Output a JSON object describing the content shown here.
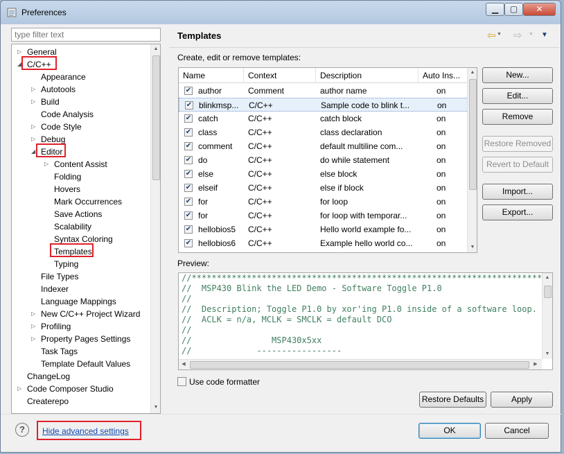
{
  "window": {
    "title": "Preferences",
    "controls": {
      "minimize": "▁",
      "maximize": "▢",
      "close": "✕"
    }
  },
  "filter": {
    "placeholder": "type filter text"
  },
  "tree": {
    "items": [
      {
        "label": "General",
        "level": 0,
        "expander": "collapsed"
      },
      {
        "label": "C/C++",
        "level": 0,
        "expander": "expanded"
      },
      {
        "label": "Appearance",
        "level": 1,
        "expander": "none"
      },
      {
        "label": "Autotools",
        "level": 1,
        "expander": "collapsed"
      },
      {
        "label": "Build",
        "level": 1,
        "expander": "collapsed"
      },
      {
        "label": "Code Analysis",
        "level": 1,
        "expander": "none"
      },
      {
        "label": "Code Style",
        "level": 1,
        "expander": "collapsed"
      },
      {
        "label": "Debug",
        "level": 1,
        "expander": "collapsed"
      },
      {
        "label": "Editor",
        "level": 1,
        "expander": "expanded"
      },
      {
        "label": "Content Assist",
        "level": 2,
        "expander": "collapsed"
      },
      {
        "label": "Folding",
        "level": 2,
        "expander": "none"
      },
      {
        "label": "Hovers",
        "level": 2,
        "expander": "none"
      },
      {
        "label": "Mark Occurrences",
        "level": 2,
        "expander": "none"
      },
      {
        "label": "Save Actions",
        "level": 2,
        "expander": "none"
      },
      {
        "label": "Scalability",
        "level": 2,
        "expander": "none"
      },
      {
        "label": "Syntax Coloring",
        "level": 2,
        "expander": "none"
      },
      {
        "label": "Templates",
        "level": 2,
        "expander": "none"
      },
      {
        "label": "Typing",
        "level": 2,
        "expander": "none"
      },
      {
        "label": "File Types",
        "level": 1,
        "expander": "none"
      },
      {
        "label": "Indexer",
        "level": 1,
        "expander": "none"
      },
      {
        "label": "Language Mappings",
        "level": 1,
        "expander": "none"
      },
      {
        "label": "New C/C++ Project Wizard",
        "level": 1,
        "expander": "collapsed"
      },
      {
        "label": "Profiling",
        "level": 1,
        "expander": "collapsed"
      },
      {
        "label": "Property Pages Settings",
        "level": 1,
        "expander": "collapsed"
      },
      {
        "label": "Task Tags",
        "level": 1,
        "expander": "none"
      },
      {
        "label": "Template Default Values",
        "level": 1,
        "expander": "none"
      },
      {
        "label": "ChangeLog",
        "level": 0,
        "expander": "none"
      },
      {
        "label": "Code Composer Studio",
        "level": 0,
        "expander": "collapsed"
      },
      {
        "label": "Createrepo",
        "level": 0,
        "expander": "none"
      }
    ]
  },
  "page": {
    "title": "Templates",
    "nav": {
      "back": "⇦",
      "forward": "⇨",
      "menu": "▼"
    },
    "description": "Create, edit or remove templates:",
    "columns": [
      "Name",
      "Context",
      "Description",
      "Auto Ins..."
    ],
    "rows": [
      {
        "checked": true,
        "name": "author",
        "context": "Comment",
        "description": "author name",
        "auto": "on"
      },
      {
        "checked": true,
        "name": "blinkmsp...",
        "context": "C/C++",
        "description": "Sample code to blink t...",
        "auto": "on"
      },
      {
        "checked": true,
        "name": "catch",
        "context": "C/C++",
        "description": "catch block",
        "auto": "on"
      },
      {
        "checked": true,
        "name": "class",
        "context": "C/C++",
        "description": "class declaration",
        "auto": "on"
      },
      {
        "checked": true,
        "name": "comment",
        "context": "C/C++",
        "description": "default multiline com...",
        "auto": "on"
      },
      {
        "checked": true,
        "name": "do",
        "context": "C/C++",
        "description": "do while statement",
        "auto": "on"
      },
      {
        "checked": true,
        "name": "else",
        "context": "C/C++",
        "description": "else block",
        "auto": "on"
      },
      {
        "checked": true,
        "name": "elseif",
        "context": "C/C++",
        "description": "else if block",
        "auto": "on"
      },
      {
        "checked": true,
        "name": "for",
        "context": "C/C++",
        "description": "for loop",
        "auto": "on"
      },
      {
        "checked": true,
        "name": "for",
        "context": "C/C++",
        "description": "for loop with temporar...",
        "auto": "on"
      },
      {
        "checked": true,
        "name": "hellobios5",
        "context": "C/C++",
        "description": "Hello world example fo...",
        "auto": "on"
      },
      {
        "checked": true,
        "name": "hellobios6",
        "context": "C/C++",
        "description": "Example hello world co...",
        "auto": "on"
      }
    ],
    "selected_row": 1,
    "buttons": {
      "new": "New...",
      "edit": "Edit...",
      "remove": "Remove",
      "restore_removed": "Restore Removed",
      "revert_default": "Revert to Default",
      "import": "Import...",
      "export": "Export..."
    },
    "preview_label": "Preview:",
    "preview_lines": [
      "//*****************************************************************************",
      "//  MSP430 Blink the LED Demo - Software Toggle P1.0",
      "//",
      "//  Description; Toggle P1.0 by xor'ing P1.0 inside of a software loop.",
      "//  ACLK = n/a, MCLK = SMCLK = default DCO",
      "//",
      "//                MSP430x5xx",
      "//             -----------------"
    ],
    "use_formatter": {
      "label": "Use code formatter",
      "checked": false
    },
    "restore_defaults": "Restore Defaults",
    "apply": "Apply"
  },
  "footer": {
    "help": "?",
    "advanced_link": "Hide advanced settings",
    "ok": "OK",
    "cancel": "Cancel"
  },
  "highlights": [
    "C/C++",
    "Editor",
    "Templates",
    "Hide advanced settings"
  ]
}
